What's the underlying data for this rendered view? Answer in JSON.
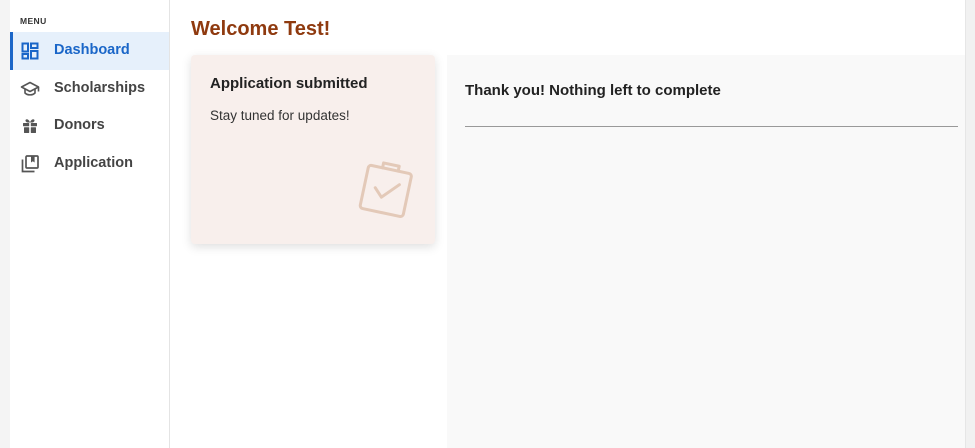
{
  "sidebar": {
    "heading": "MENU",
    "items": [
      {
        "label": "Dashboard",
        "icon": "dashboard-icon",
        "active": true
      },
      {
        "label": "Scholarships",
        "icon": "graduation-cap-icon",
        "active": false
      },
      {
        "label": "Donors",
        "icon": "gift-icon",
        "active": false
      },
      {
        "label": "Application",
        "icon": "library-books-icon",
        "active": false
      }
    ]
  },
  "main": {
    "welcome": "Welcome Test!",
    "status_card": {
      "title": "Application submitted",
      "subtitle": "Stay tuned for updates!",
      "icon": "clipboard-check-icon"
    },
    "tasks": {
      "title": "Thank you! Nothing left to complete"
    }
  },
  "colors": {
    "accent": "#1a66c8",
    "active_bg": "#e6f0fb",
    "welcome": "#8f3a0f",
    "card_bg": "#f8efec",
    "card_icon": "#e3c9b8",
    "panel_bg": "#f9f9f9"
  }
}
